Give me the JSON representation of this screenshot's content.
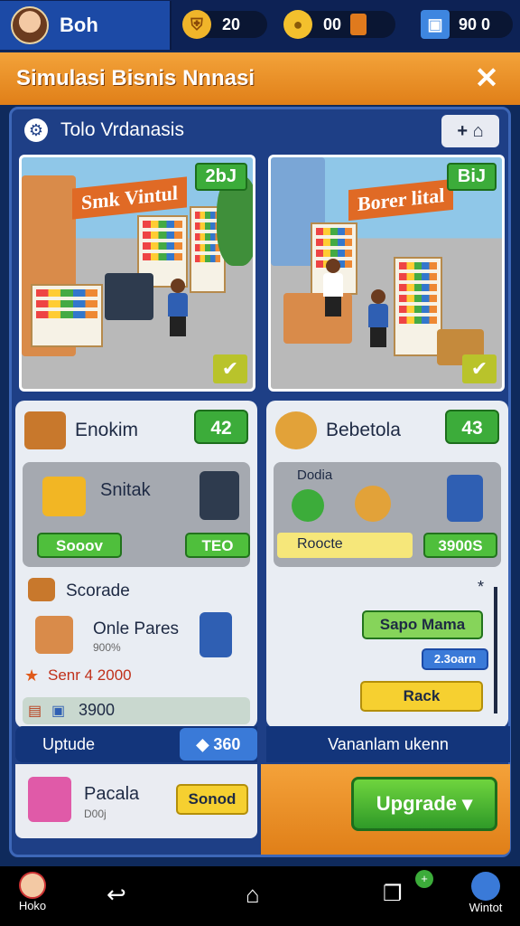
{
  "topbar": {
    "profile_name": "Boh",
    "resources": [
      {
        "icon": "shield-coin-icon",
        "value": "20"
      },
      {
        "icon": "gold-coin-icon",
        "value": "00"
      },
      {
        "icon": "gem-box-icon",
        "value": "90 0"
      }
    ]
  },
  "banner": {
    "title": "Simulasi Bisnis Nnnasi",
    "close_glyph": "✕"
  },
  "section": {
    "title": "Tolo Vrdanasis",
    "corner_label": "+ ⌂"
  },
  "stores": [
    {
      "sign": "Smk Vintul",
      "price": "2bJ",
      "check": "✔"
    },
    {
      "sign": "Borer lital",
      "price": "BiJ",
      "check": "✔"
    }
  ],
  "card_left": {
    "title": "Enokim",
    "badge": "42",
    "sub_title": "Snitak",
    "button_left": "Sooov",
    "button_right": "TEO",
    "upgrade_title": "Scorade",
    "item_name": "Onle Pares",
    "item_sub": "900%",
    "price_line": "Senr 4 2000",
    "total": "3900"
  },
  "card_right": {
    "title": "Bebetola",
    "badge": "43",
    "sub_title": "Dodia",
    "highlight": "Roocte",
    "button_right": "3900S",
    "close_glyph": "*",
    "btn_green": "Sapo Mama",
    "btn_blue": "2.3oarn",
    "btn_yellow": "Rack"
  },
  "bars": {
    "left_label": "Uptude",
    "left_value": "360",
    "right_label": "Vananlam ukenn"
  },
  "bottom": {
    "pack_name": "Pacala",
    "pack_sub": "D00j",
    "sound_btn": "Sonod",
    "upgrade_btn": "Upgrade"
  },
  "navbar": {
    "left_label": "Hoko",
    "right_label": "Wintot"
  }
}
